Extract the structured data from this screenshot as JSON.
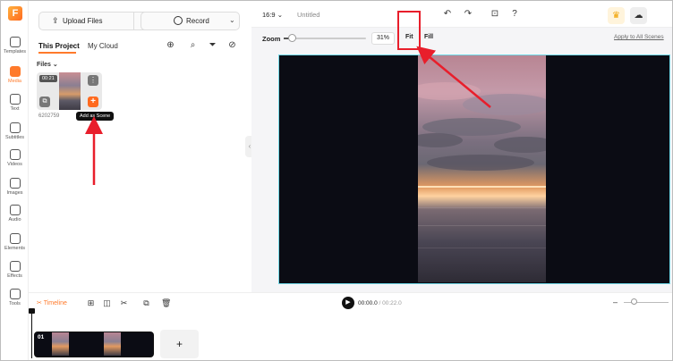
{
  "sidebar": {
    "logo": "F",
    "items": [
      {
        "label": "Templates",
        "icon": "templates-icon"
      },
      {
        "label": "Media",
        "icon": "media-icon",
        "active": true
      },
      {
        "label": "Text",
        "icon": "text-icon"
      },
      {
        "label": "Subtitles",
        "icon": "subtitles-icon"
      },
      {
        "label": "Videos",
        "icon": "videos-icon"
      },
      {
        "label": "Images",
        "icon": "images-icon"
      },
      {
        "label": "Audio",
        "icon": "audio-icon"
      },
      {
        "label": "Elements",
        "icon": "elements-icon"
      },
      {
        "label": "Effects",
        "icon": "effects-icon"
      },
      {
        "label": "Tools",
        "icon": "tools-icon"
      }
    ]
  },
  "media_panel": {
    "upload_label": "Upload Files",
    "record_label": "Record",
    "tabs": [
      "This Project",
      "My Cloud"
    ],
    "files_label": "Files",
    "file": {
      "duration": "00:21",
      "name": "6202759"
    },
    "tooltip": "Add as Scene"
  },
  "topbar": {
    "aspect_ratio": "16:9",
    "title": "Untitled"
  },
  "zoom": {
    "label": "Zoom",
    "value": "31%",
    "level": 0.31,
    "fit": "Fit",
    "fill": "Fill",
    "apply_all": "Apply to All Scenes"
  },
  "timeline": {
    "label": "Timeline",
    "current_time": "00:00.0",
    "total_time": "/ 00:22.0",
    "clip_number": "01",
    "add": "+"
  },
  "colors": {
    "accent": "#ff7a2b",
    "annotation": "#e81e2b",
    "stage_border": "#6fd7e6"
  }
}
